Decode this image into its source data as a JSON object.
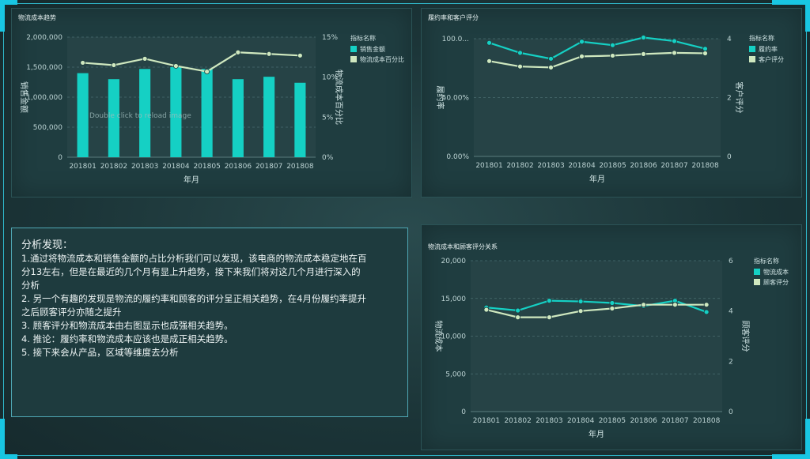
{
  "colors": {
    "primary": "#15d0c4",
    "secondary": "#cfe8bf"
  },
  "panels": {
    "chart1_title": "物流成本趋势",
    "chart2_title": "履约率和客户评分",
    "chart3_title": "物流成本和顾客评分关系",
    "ghost_text": "Double click to reload image"
  },
  "analysis": {
    "title": "分析发现：",
    "lines": [
      "1.通过将物流成本和销售金额的占比分析我们可以发现，该电商的物流成本稳定地在百",
      "分13左右，但是在最近的几个月有显上升趋势，接下来我们将对这几个月进行深入的",
      "分析",
      "2. 另一个有趣的发现是物流的履约率和顾客的评分呈正相关趋势，在4月份履约率提升",
      "之后顾客评分亦随之提升",
      "3. 顾客评分和物流成本由右图显示也成强相关趋势。",
      "4. 推论：履约率和物流成本应该也是成正相关趋势。",
      "5. 接下来会从产品，区域等维度去分析"
    ]
  },
  "chart_data": [
    {
      "type": "bar+line",
      "categories": [
        "201801",
        "201802",
        "201803",
        "201804",
        "201805",
        "201806",
        "201807",
        "201808"
      ],
      "xlabel": "年月",
      "ylabel": "销售金额",
      "y2label": "物流成本百分比",
      "ylim": [
        0,
        2000000
      ],
      "yticks": [
        "0",
        "500,000",
        "1,000,000",
        "1,500,000",
        "2,000,000"
      ],
      "y2lim": [
        0,
        15
      ],
      "y2ticks": [
        "0%",
        "5%",
        "10%",
        "15%"
      ],
      "legend_title": "指标名称",
      "series": [
        {
          "name": "销售金额",
          "kind": "bar",
          "values": [
            1400000,
            1300000,
            1470000,
            1500000,
            1470000,
            1300000,
            1340000,
            1240000
          ]
        },
        {
          "name": "物流成本百分比",
          "kind": "line",
          "values": [
            11.8,
            11.5,
            12.3,
            11.4,
            10.7,
            13.1,
            12.9,
            12.7
          ]
        }
      ]
    },
    {
      "type": "line",
      "categories": [
        "201801",
        "201802",
        "201803",
        "201804",
        "201805",
        "201806",
        "201807",
        "201808"
      ],
      "xlabel": "年月",
      "ylabel": "履约率",
      "y2label": "客户评分",
      "ylim": [
        0,
        100
      ],
      "yticks": [
        "0.00%",
        "50.00%",
        "100.0..."
      ],
      "y2lim": [
        0,
        5
      ],
      "y2ticks": [
        "0",
        "2",
        "4"
      ],
      "legend_title": "指标名称",
      "series": [
        {
          "name": "履约率",
          "axis": "left",
          "values": [
            96.5,
            88,
            83,
            97.5,
            94.5,
            101,
            98,
            91.5
          ]
        },
        {
          "name": "客户评分",
          "axis": "right",
          "values": [
            4.05,
            3.82,
            3.78,
            4.25,
            4.28,
            4.35,
            4.4,
            4.38
          ]
        }
      ]
    },
    {
      "type": "line",
      "categories": [
        "201801",
        "201802",
        "201803",
        "201804",
        "201805",
        "201806",
        "201807",
        "201808"
      ],
      "xlabel": "年月",
      "ylabel": "物流成本",
      "y2label": "顾客评分",
      "ylim": [
        0,
        20000
      ],
      "yticks": [
        "0",
        "5,000",
        "10,000",
        "15,000",
        "20,000"
      ],
      "y2lim": [
        0,
        6
      ],
      "y2ticks": [
        "0",
        "2",
        "4",
        "6"
      ],
      "legend_title": "指标名称",
      "series": [
        {
          "name": "物流成本",
          "axis": "left",
          "values": [
            13800,
            13400,
            14700,
            14600,
            14400,
            14000,
            14700,
            13200
          ]
        },
        {
          "name": "顾客评分",
          "axis": "right",
          "values": [
            4.05,
            3.75,
            3.75,
            4.0,
            4.1,
            4.25,
            4.25,
            4.25
          ]
        }
      ]
    }
  ]
}
